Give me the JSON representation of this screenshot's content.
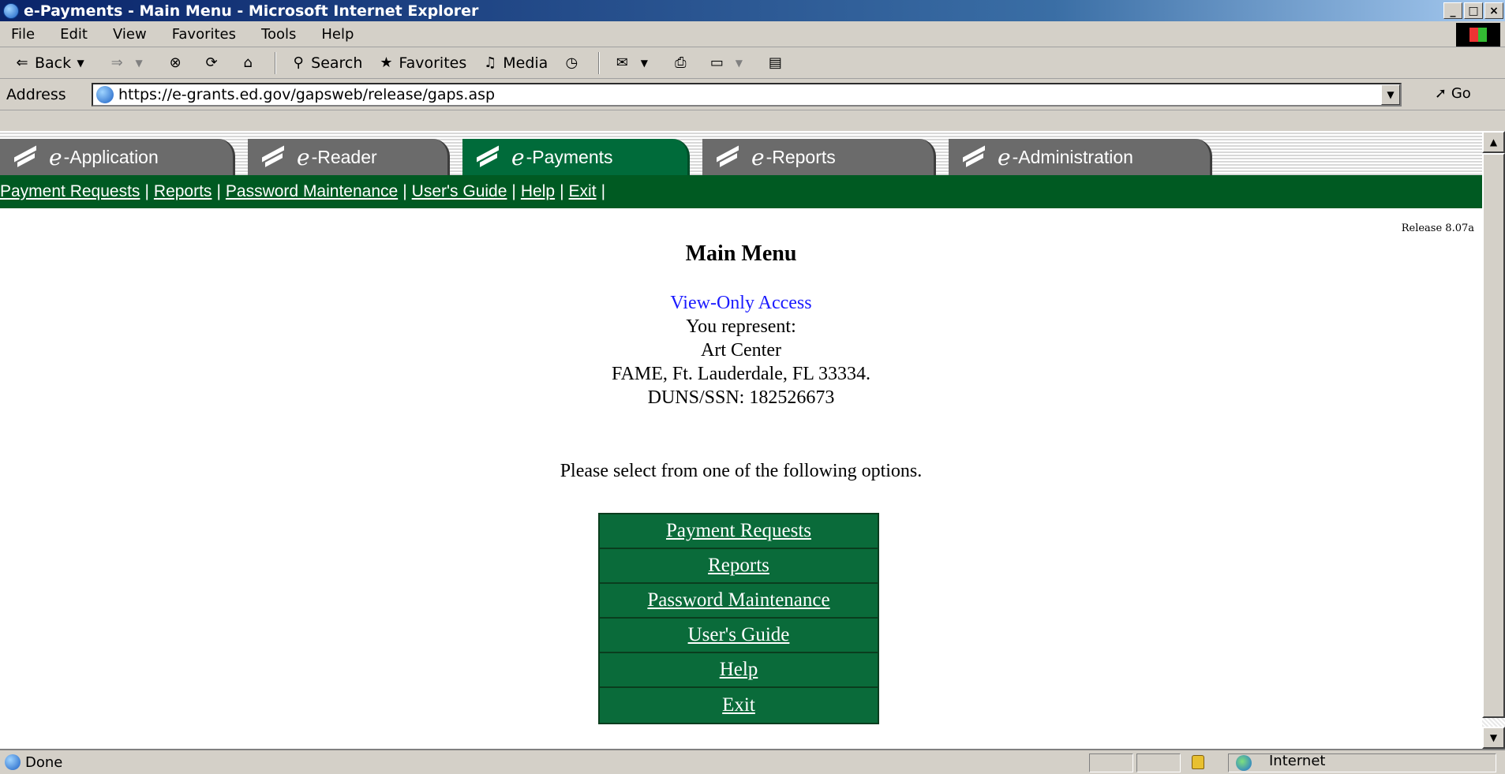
{
  "window": {
    "title": "e-Payments - Main Menu - Microsoft Internet Explorer",
    "buttons": [
      "_",
      "□",
      "×"
    ]
  },
  "menubar": {
    "items": [
      "File",
      "Edit",
      "View",
      "Favorites",
      "Tools",
      "Help"
    ]
  },
  "toolbar": {
    "back": "Back",
    "search": "Search",
    "favorites": "Favorites",
    "media": "Media"
  },
  "address": {
    "label": "Address",
    "url": "https://e-grants.ed.gov/gapsweb/release/gaps.asp",
    "go": "Go"
  },
  "tabs": [
    {
      "e": "e",
      "label": "-Application"
    },
    {
      "e": "e",
      "label": "-Reader"
    },
    {
      "e": "e",
      "label": "-Payments"
    },
    {
      "e": "e",
      "label": "-Reports"
    },
    {
      "e": "e",
      "label": "-Administration"
    }
  ],
  "nav": {
    "links": [
      "Payment Requests",
      "Reports",
      "Password Maintenance",
      "User's Guide",
      "Help",
      "Exit"
    ]
  },
  "page": {
    "release": "Release 8.07a",
    "title": "Main Menu",
    "access": "View-Only Access",
    "represent": "You represent:",
    "org": "Art Center",
    "location": "FAME, Ft. Lauderdale, FL 33334.",
    "duns": "DUNS/SSN: 182526673",
    "instructions": "Please select from one of the following options.",
    "options": [
      "Payment Requests",
      "Reports",
      "Password Maintenance",
      "User's Guide",
      "Help",
      "Exit"
    ]
  },
  "status": {
    "text": "Done",
    "zone": "Internet"
  },
  "colors": {
    "title_bar": "#0a246a",
    "active_tab": "#006b3a",
    "nav_strip": "#005a22",
    "menu_button": "#0a6b3a",
    "access_link": "#1a1aff"
  }
}
